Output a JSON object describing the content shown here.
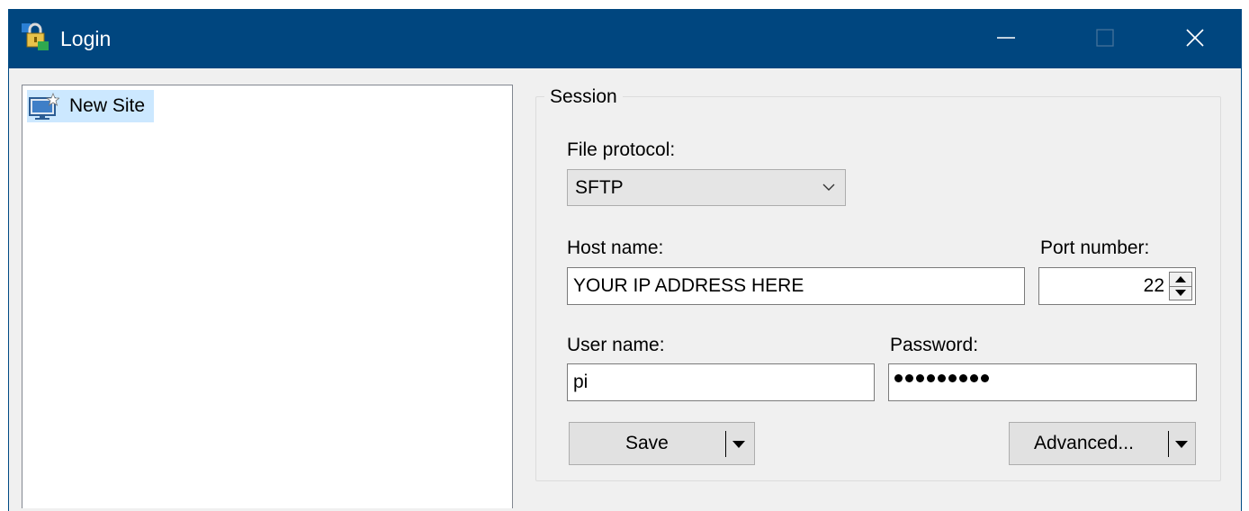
{
  "window": {
    "title": "Login"
  },
  "site_tree": {
    "items": [
      {
        "label": "New Site",
        "icon": "monitor-star-icon",
        "selected": true
      }
    ]
  },
  "session": {
    "group_title": "Session",
    "file_protocol": {
      "label": "File protocol:",
      "value": "SFTP"
    },
    "host": {
      "label": "Host name:",
      "value": "YOUR IP ADDRESS HERE"
    },
    "port": {
      "label": "Port number:",
      "value": "22"
    },
    "user": {
      "label": "User name:",
      "value": "pi"
    },
    "password": {
      "label": "Password:",
      "masked_length": 9
    },
    "save_label": "Save",
    "advanced_label": "Advanced..."
  },
  "colors": {
    "titlebar": "#00467f",
    "selection": "#cce8ff",
    "face": "#f0f0f0"
  }
}
